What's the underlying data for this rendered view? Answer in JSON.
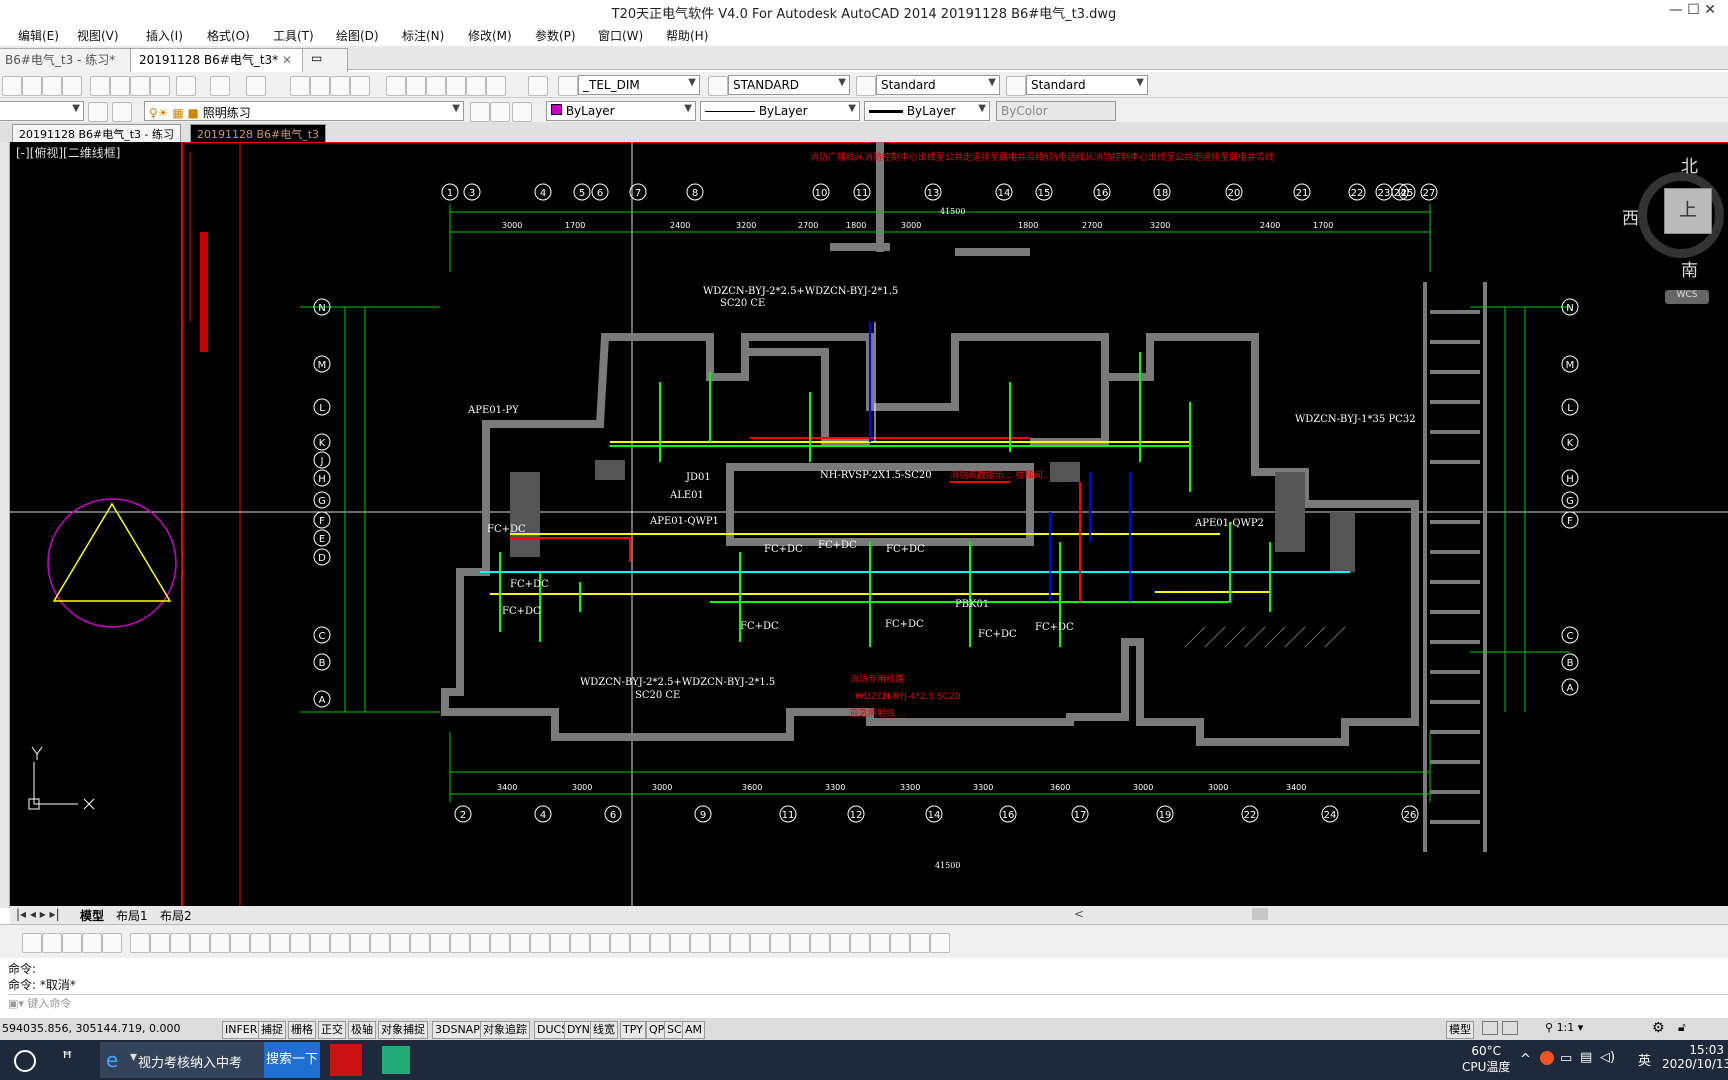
{
  "window": {
    "title": "T20天正电气软件 V4.0 For Autodesk AutoCAD 2014     20191128 B6#电气_t3.dwg"
  },
  "menu": [
    "编辑(E)",
    "视图(V)",
    "插入(I)",
    "格式(O)",
    "工具(T)",
    "绘图(D)",
    "标注(N)",
    "修改(M)",
    "参数(P)",
    "窗口(W)",
    "帮助(H)"
  ],
  "doc_tabs": [
    {
      "label": "B6#电气_t3 - 练习*",
      "active": false
    },
    {
      "label": "20191128 B6#电气_t3*",
      "active": true
    }
  ],
  "styles": {
    "dimstyle": "_TEL_DIM",
    "textstyle": "STANDARD",
    "tablestyle": "Standard",
    "mleaderstyle": "Standard"
  },
  "layer": {
    "current": "照明练习"
  },
  "props": {
    "color": "ByLayer",
    "linetype": "ByLayer",
    "lineweight": "ByLayer",
    "plotstyle": "ByColor"
  },
  "layout_file_tabs": [
    "20191128 B6#电气_t3 - 练习",
    "20191128 B6#电气_t3"
  ],
  "viewport_label": "[-][俯视][二维线框]",
  "viewcube": {
    "north": "北",
    "south": "南",
    "west": "西",
    "top": "上",
    "wcs": "WCS"
  },
  "model_tabs": [
    "模型",
    "布局1",
    "布局2"
  ],
  "command_lines": [
    "命令:",
    "命令: *取消*"
  ],
  "command_placeholder": "键入命令",
  "coords": "594035.856, 305144.719, 0.000",
  "status_toggles": [
    "INFER",
    "捕捉",
    "栅格",
    "正交",
    "极轴",
    "对象捕捉",
    "3DSNAP",
    "对象追踪",
    "DUCS",
    "DYN",
    "线宽",
    "TPY",
    "QP",
    "SC",
    "AM"
  ],
  "status_right": {
    "model": "模型",
    "scale": "1:1"
  },
  "taskbar": {
    "browser_title": "视力考核纳入中考",
    "search_button": "搜索一下",
    "temp": "60°C",
    "cpu": "CPU温度",
    "ime": "英",
    "time": "15:03",
    "date": "2020/10/13"
  },
  "drawing_labels": {
    "top_dim_total": "41500",
    "bottom_dim_total": "41500",
    "cable_right": "WDZCN-BYJ-1*35 PC32",
    "cable_top": "WDZCN-BYJ-2*2.5+WDZCN-BYJ-2*1.5",
    "cable_top_pipe": "SC20 CE",
    "cable_bottom": "WDZCN-BYJ-2*2.5+WDZCN-BYJ-2*1.5",
    "cable_bottom_pipe": "SC20 CE",
    "cable_red": "WDZCN-BYJ-4*2.5 SC20",
    "ape_left": "APE01-PY",
    "ape_right": "APE01-QWP2",
    "ape_mid": "APE01-QWP1",
    "ale": "ALE01",
    "jd": "JD01",
    "nh": "NH-RVSP-2X1.5-SC20",
    "pbk": "PBK01",
    "fcdc": "FC+DC"
  },
  "axis_top": [
    "1",
    "3",
    "4",
    "5",
    "6",
    "7",
    "8",
    "10",
    "11",
    "13",
    "14",
    "15",
    "16",
    "18",
    "20",
    "21",
    "22",
    "23",
    "24",
    "25",
    "27"
  ],
  "axis_bottom": [
    "2",
    "4",
    "6",
    "9",
    "11",
    "12",
    "14",
    "16",
    "17",
    "19",
    "22",
    "24",
    "26"
  ],
  "axis_left": [
    "N",
    "M",
    "L",
    "K",
    "J",
    "H",
    "G",
    "F",
    "E",
    "D",
    "C",
    "B",
    "A"
  ],
  "dims_top": [
    "3000",
    "1700",
    "2400",
    "3200",
    "2700",
    "1800",
    "3000",
    "1800",
    "2700",
    "3200",
    "2400",
    "1700"
  ],
  "dims_bottom": [
    "3400",
    "3000",
    "3000",
    "3600",
    "3300",
    "3300",
    "3300",
    "3600",
    "3000",
    "3000",
    "3400"
  ]
}
